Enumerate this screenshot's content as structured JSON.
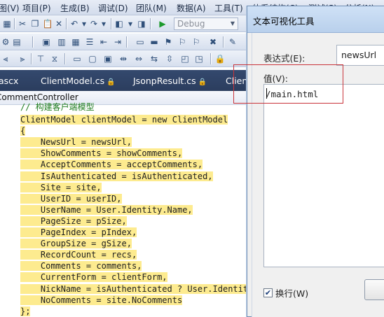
{
  "menu": [
    "视图(V)",
    "项目(P)",
    "生成(B)",
    "调试(D)",
    "团队(M)",
    "数据(A)",
    "工具(T)",
    "体系结构(C)",
    "测试(S)",
    "分析(N)"
  ],
  "toolbar": {
    "configuration": "Debug"
  },
  "tabs": [
    {
      "label": "ascx"
    },
    {
      "label": "ClientModel.cs"
    },
    {
      "label": "JsonpResult.cs"
    },
    {
      "label": "Client"
    }
  ],
  "editor": {
    "nav_class": "CommentController",
    "comment_line": "// 构建客户端模型",
    "lines": [
      "ClientModel clientModel = new ClientModel",
      "{",
      "    NewsUrl = newsUrl,",
      "    ShowComments = showComments,",
      "    AcceptComments = acceptComments,",
      "    IsAuthenticated = isAuthenticated,",
      "    Site = site,",
      "    UserID = userID,",
      "    UserName = User.Identity.Name,",
      "    PageSize = pSize,",
      "    PageIndex = pIndex,",
      "    GroupSize = gSize,",
      "    RecordCount = recs,",
      "    Comments = comments,",
      "    CurrentForm = clientForm,",
      "    NickName = isAuthenticated ? User.Identity.Name : site.DefaultNickName",
      "    NoComments = site.NoComments",
      "};"
    ]
  },
  "dialog": {
    "title": "文本可视化工具",
    "expression_label": "表达式(E):",
    "expression_value": "newsUrl",
    "value_label": "值(V):",
    "value_text": "/main.html",
    "wrap_label": "换行(W)",
    "wrap_checked": true
  }
}
